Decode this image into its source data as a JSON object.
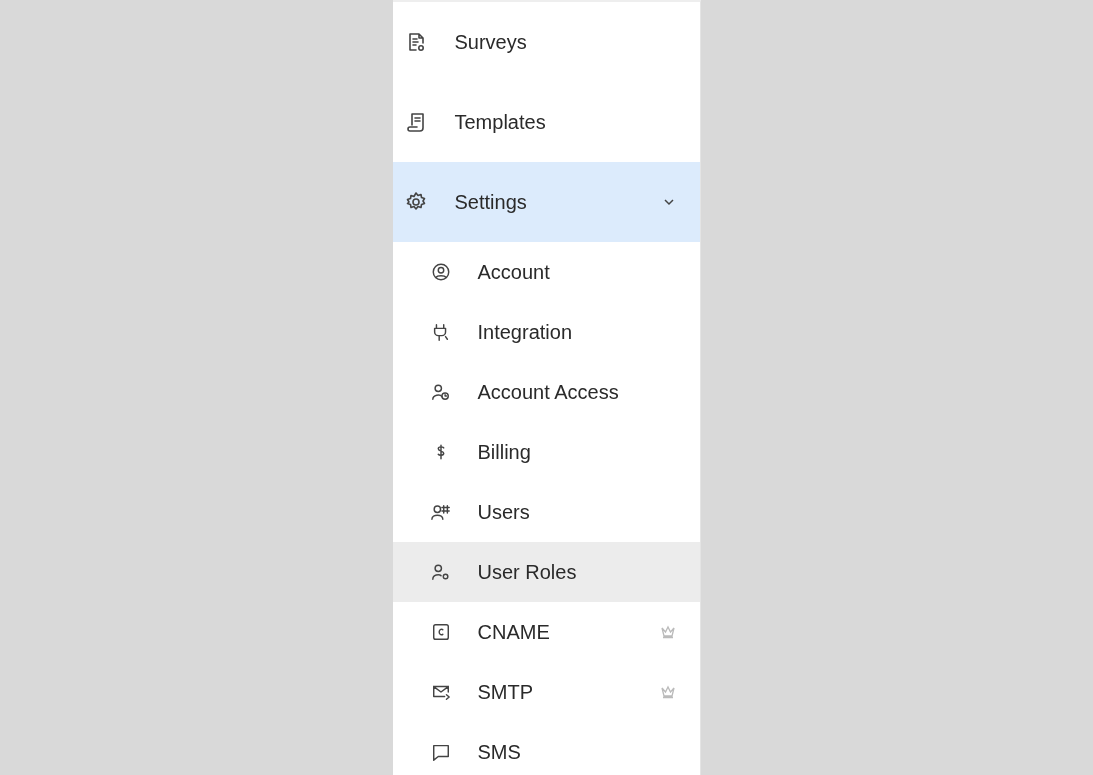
{
  "sidebar": {
    "items": [
      {
        "label": "Surveys",
        "selected": false
      },
      {
        "label": "Templates",
        "selected": false
      },
      {
        "label": "Settings",
        "selected": true,
        "expanded": true,
        "children": [
          {
            "label": "Account",
            "selected": false,
            "premium": false
          },
          {
            "label": "Integration",
            "selected": false,
            "premium": false
          },
          {
            "label": "Account Access",
            "selected": false,
            "premium": false
          },
          {
            "label": "Billing",
            "selected": false,
            "premium": false
          },
          {
            "label": "Users",
            "selected": false,
            "premium": false
          },
          {
            "label": "User Roles",
            "selected": true,
            "premium": false
          },
          {
            "label": "CNAME",
            "selected": false,
            "premium": true
          },
          {
            "label": "SMTP",
            "selected": false,
            "premium": true
          },
          {
            "label": "SMS",
            "selected": false,
            "premium": false
          }
        ]
      }
    ]
  }
}
